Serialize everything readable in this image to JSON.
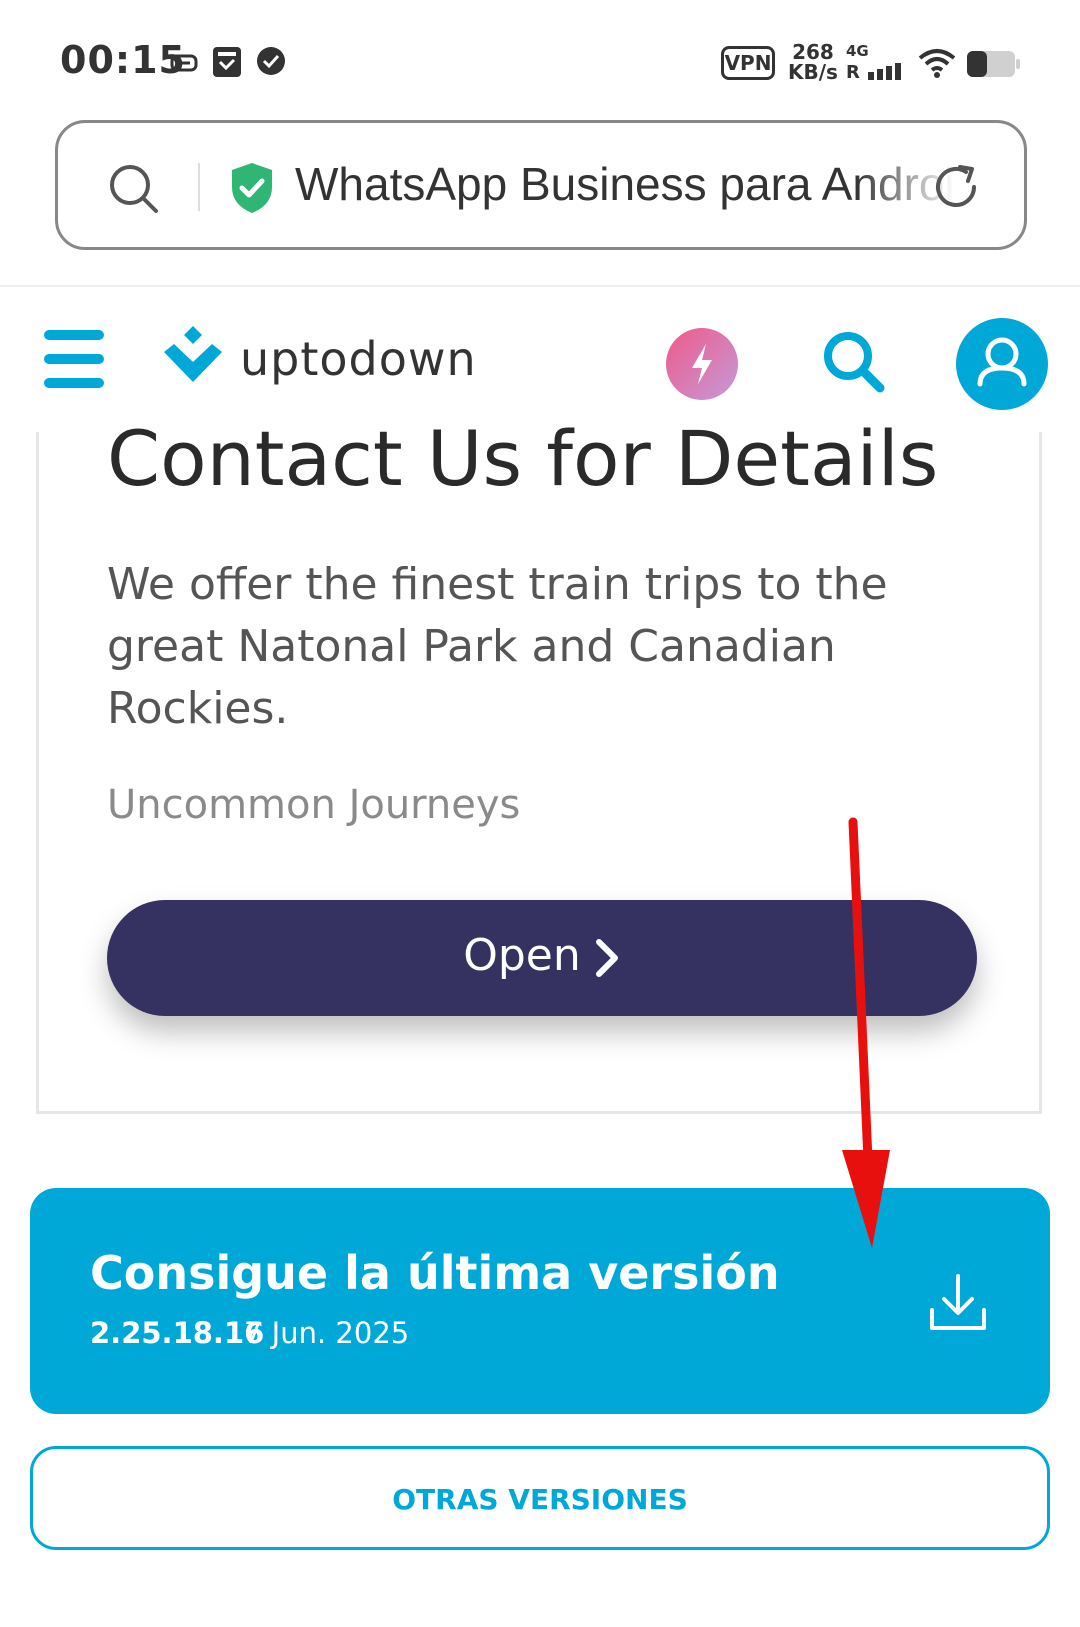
{
  "status_bar": {
    "time": "00:15",
    "vpn_label": "VPN",
    "net_speed_value": "268",
    "net_speed_unit": "KB/s",
    "network_type": "4G",
    "roaming": "R",
    "icons": [
      "link-icon",
      "sim-card-icon",
      "check-circle-icon",
      "signal-icon",
      "wifi-icon",
      "battery-icon"
    ]
  },
  "url_bar": {
    "page_title": "WhatsApp Business para Android",
    "secure": true
  },
  "site_header": {
    "logo_text": "uptodown",
    "accent_color": "#00a8d8"
  },
  "ad": {
    "title": "Contact Us for Details",
    "description": "We offer the finest train trips to the great Natonal Park and Canadian Rockies.",
    "brand": "Uncommon Journeys",
    "cta_label": "Open",
    "cta_color": "#353262"
  },
  "download": {
    "title": "Consigue la última versión",
    "version": "2.25.18.16",
    "date": "7 Jun. 2025"
  },
  "other_versions": {
    "label": "OTRAS VERSIONES"
  },
  "annotation": {
    "arrow_color": "#e8100f"
  }
}
